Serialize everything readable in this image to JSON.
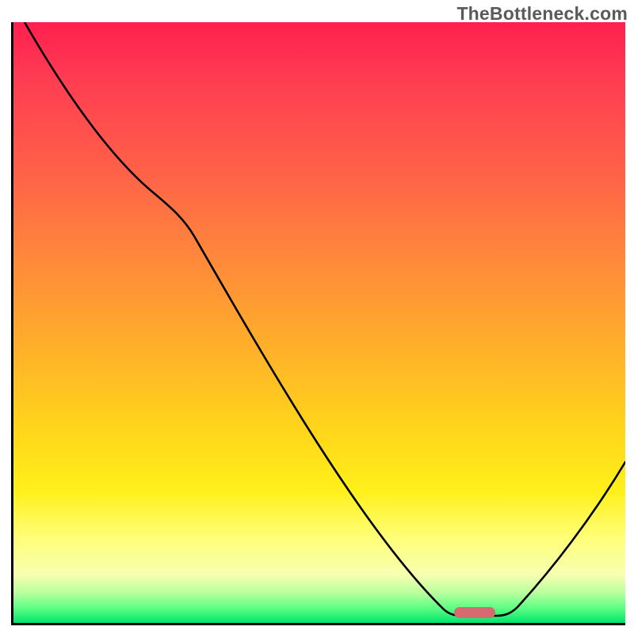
{
  "chart_data": {
    "type": "line",
    "watermark": "TheBottleneck.com",
    "axes": {
      "x": {
        "label": "",
        "ticks": [],
        "range_normalized": [
          0,
          1
        ]
      },
      "y": {
        "label": "",
        "ticks": [],
        "range_normalized": [
          0,
          1
        ]
      }
    },
    "background_gradient": {
      "description": "vertical severity gradient, red at top (worst) to green at bottom (best)",
      "stops": [
        {
          "pos": 0.0,
          "color": "#ff1f4f"
        },
        {
          "pos": 0.09,
          "color": "#ff3b53"
        },
        {
          "pos": 0.25,
          "color": "#ff6148"
        },
        {
          "pos": 0.4,
          "color": "#ff8a3a"
        },
        {
          "pos": 0.55,
          "color": "#ffb229"
        },
        {
          "pos": 0.68,
          "color": "#ffd61a"
        },
        {
          "pos": 0.78,
          "color": "#fff01a"
        },
        {
          "pos": 0.86,
          "color": "#ffff7a"
        },
        {
          "pos": 0.92,
          "color": "#f6ffb0"
        },
        {
          "pos": 0.95,
          "color": "#b9ff9e"
        },
        {
          "pos": 0.975,
          "color": "#5eff84"
        },
        {
          "pos": 1.0,
          "color": "#00e56a"
        }
      ]
    },
    "series": [
      {
        "name": "bottleneck-curve",
        "note": "x,y in normalized 0–1 plot coordinates; y=0 is top (high bottleneck), y=1 is bottom (no bottleneck)",
        "points": [
          {
            "x": 0.018,
            "y": 0.0
          },
          {
            "x": 0.12,
            "y": 0.15
          },
          {
            "x": 0.233,
            "y": 0.288
          },
          {
            "x": 0.295,
            "y": 0.356
          },
          {
            "x": 0.43,
            "y": 0.575
          },
          {
            "x": 0.57,
            "y": 0.82
          },
          {
            "x": 0.702,
            "y": 0.977
          },
          {
            "x": 0.732,
            "y": 0.988
          },
          {
            "x": 0.79,
            "y": 0.988
          },
          {
            "x": 0.824,
            "y": 0.974
          },
          {
            "x": 0.9,
            "y": 0.87
          },
          {
            "x": 1.0,
            "y": 0.732
          }
        ]
      }
    ],
    "marker": {
      "name": "optimal-point",
      "x_normalized": 0.755,
      "y_normalized": 0.985,
      "color": "#d66a6e",
      "shape": "pill"
    }
  }
}
